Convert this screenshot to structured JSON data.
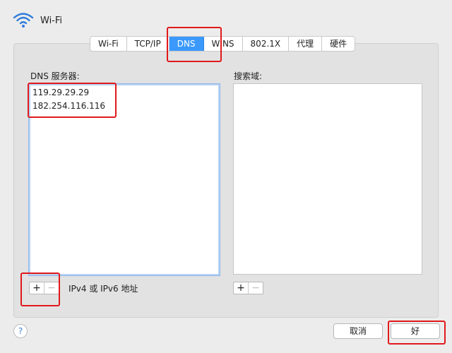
{
  "window": {
    "title": "Wi-Fi"
  },
  "icons": {
    "wifi": "wifi-icon",
    "help": "question-icon"
  },
  "tabs": [
    {
      "label": "Wi-Fi",
      "active": false
    },
    {
      "label": "TCP/IP",
      "active": false
    },
    {
      "label": "DNS",
      "active": true
    },
    {
      "label": "WINS",
      "active": false
    },
    {
      "label": "802.1X",
      "active": false
    },
    {
      "label": "代理",
      "active": false
    },
    {
      "label": "硬件",
      "active": false
    }
  ],
  "dns": {
    "label": "DNS 服务器:",
    "servers": [
      "119.29.29.29",
      "182.254.116.116"
    ],
    "hint": "IPv4 或 IPv6 地址",
    "add": "+",
    "remove": "−"
  },
  "search": {
    "label": "搜索域:",
    "domains": [],
    "add": "+",
    "remove": "−"
  },
  "footer": {
    "help": "?",
    "cancel": "取消",
    "ok": "好"
  },
  "colors": {
    "accent": "#3b99fc",
    "highlight": "#e1191b"
  }
}
